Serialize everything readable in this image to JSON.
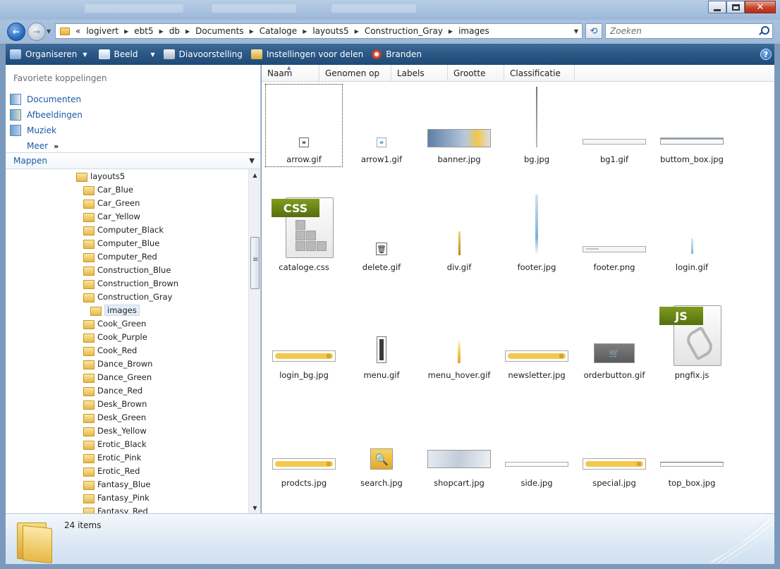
{
  "address": {
    "overflow": "«",
    "crumbs": [
      "logivert",
      "ebt5",
      "db",
      "Documents",
      "Cataloge",
      "layouts5",
      "Construction_Gray",
      "images"
    ]
  },
  "search": {
    "placeholder": "Zoeken"
  },
  "toolbar": {
    "organize": "Organiseren",
    "view": "Beeld",
    "slideshow": "Diavoorstelling",
    "share": "Instellingen voor delen",
    "burn": "Branden"
  },
  "nav": {
    "favorites_title": "Favoriete koppelingen",
    "favorites": [
      "Documenten",
      "Afbeeldingen",
      "Muziek"
    ],
    "more": "Meer",
    "folders_title": "Mappen"
  },
  "tree": {
    "root": "layouts5",
    "children": [
      "Car_Blue",
      "Car_Green",
      "Car_Yellow",
      "Computer_Black",
      "Computer_Blue",
      "Computer_Red",
      "Construction_Blue",
      "Construction_Brown",
      "Construction_Gray"
    ],
    "selected": "images",
    "after": [
      "Cook_Green",
      "Cook_Purple",
      "Cook_Red",
      "Dance_Brown",
      "Dance_Green",
      "Dance_Red",
      "Desk_Brown",
      "Desk_Green",
      "Desk_Yellow",
      "Erotic_Black",
      "Erotic_Pink",
      "Erotic_Red",
      "Fantasy_Blue",
      "Fantasy_Pink",
      "Fantasy_Red"
    ]
  },
  "columns": [
    "Naam",
    "Genomen op",
    "Labels",
    "Grootte",
    "Classificatie"
  ],
  "files": [
    {
      "name": "arrow.gif",
      "thumb": "arrow"
    },
    {
      "name": "arrow1.gif",
      "thumb": "arrow-blue"
    },
    {
      "name": "banner.jpg",
      "thumb": "banner"
    },
    {
      "name": "bg.jpg",
      "thumb": "vline"
    },
    {
      "name": "bg1.gif",
      "thumb": "bar"
    },
    {
      "name": "buttom_box.jpg",
      "thumb": "bar2"
    },
    {
      "name": "cataloge.css",
      "thumb": "css"
    },
    {
      "name": "delete.gif",
      "thumb": "trash"
    },
    {
      "name": "div.gif",
      "thumb": "div"
    },
    {
      "name": "footer.jpg",
      "thumb": "footerjpg"
    },
    {
      "name": "footer.png",
      "thumb": "footerpng"
    },
    {
      "name": "login.gif",
      "thumb": "login"
    },
    {
      "name": "login_bg.jpg",
      "thumb": "yellowbar"
    },
    {
      "name": "menu.gif",
      "thumb": "menu"
    },
    {
      "name": "menu_hover.gif",
      "thumb": "menuhover"
    },
    {
      "name": "newsletter.jpg",
      "thumb": "yellowbar"
    },
    {
      "name": "orderbutton.gif",
      "thumb": "order"
    },
    {
      "name": "pngfix.js",
      "thumb": "js"
    },
    {
      "name": "prodcts.jpg",
      "thumb": "yellowbar"
    },
    {
      "name": "search.jpg",
      "thumb": "searchjpg"
    },
    {
      "name": "shopcart.jpg",
      "thumb": "shopcart"
    },
    {
      "name": "side.jpg",
      "thumb": "side"
    },
    {
      "name": "special.jpg",
      "thumb": "yellowbar"
    },
    {
      "name": "top_box.jpg",
      "thumb": "topbox"
    }
  ],
  "status": {
    "count": "24 items"
  },
  "colors": {
    "accent": "#1c59a6",
    "toolbar": "#2b5785",
    "folder": "#e6b84a"
  }
}
